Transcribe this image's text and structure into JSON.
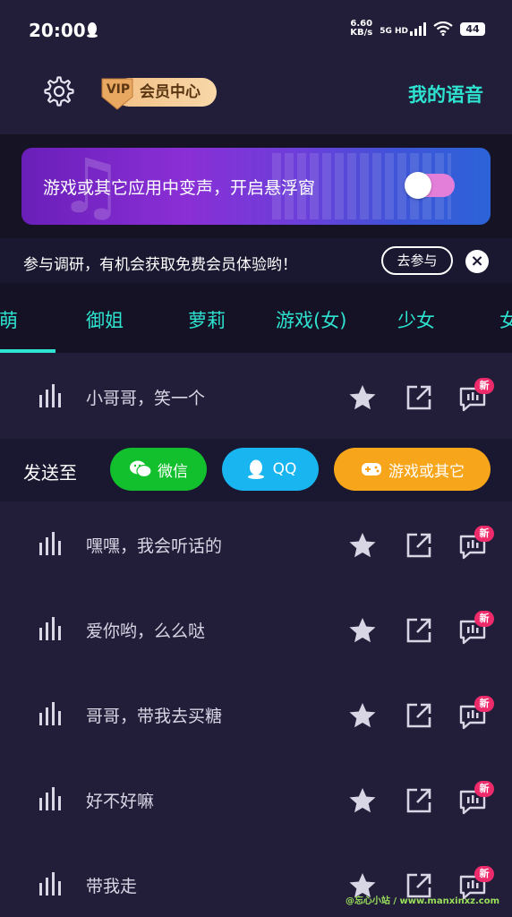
{
  "status_bar": {
    "time": "20:00",
    "net_speed_value": "6.60",
    "net_speed_unit": "KB/s",
    "signal": "5G HD",
    "battery": "44"
  },
  "header": {
    "vip_badge": "VIP",
    "vip_center": "会员中心",
    "my_voice": "我的语音"
  },
  "banner": {
    "text": "游戏或其它应用中变声，开启悬浮窗",
    "toggle_on": false
  },
  "survey": {
    "text": "参与调研，有机会获取免费会员体验哟！",
    "button": "去参与",
    "close": "×"
  },
  "tabs": [
    {
      "label": "呆萌"
    },
    {
      "label": "御姐"
    },
    {
      "label": "萝莉"
    },
    {
      "label": "游戏(女)"
    },
    {
      "label": "少女"
    },
    {
      "label": "女"
    }
  ],
  "voice_list": [
    {
      "label": "小哥哥，笑一个",
      "new_badge": "新"
    },
    {
      "label": "嘿嘿，我会听话的",
      "new_badge": "新"
    },
    {
      "label": "爱你哟，么么哒",
      "new_badge": "新"
    },
    {
      "label": "哥哥，带我去买糖",
      "new_badge": "新"
    },
    {
      "label": "好不好嘛",
      "new_badge": "新"
    },
    {
      "label": "带我走",
      "new_badge": "新"
    }
  ],
  "send_bar": {
    "label": "发送至",
    "wechat": "微信",
    "qq": "QQ",
    "game": "游戏或其它"
  },
  "colors": {
    "accent": "#2ee3d0",
    "background": "#221e3a",
    "wechat": "#12c02d",
    "qq": "#18b5f0",
    "game": "#f7a51a",
    "new_badge": "#ee2a6b"
  },
  "watermark": "@忘心小站 / www.manxinxz.com"
}
